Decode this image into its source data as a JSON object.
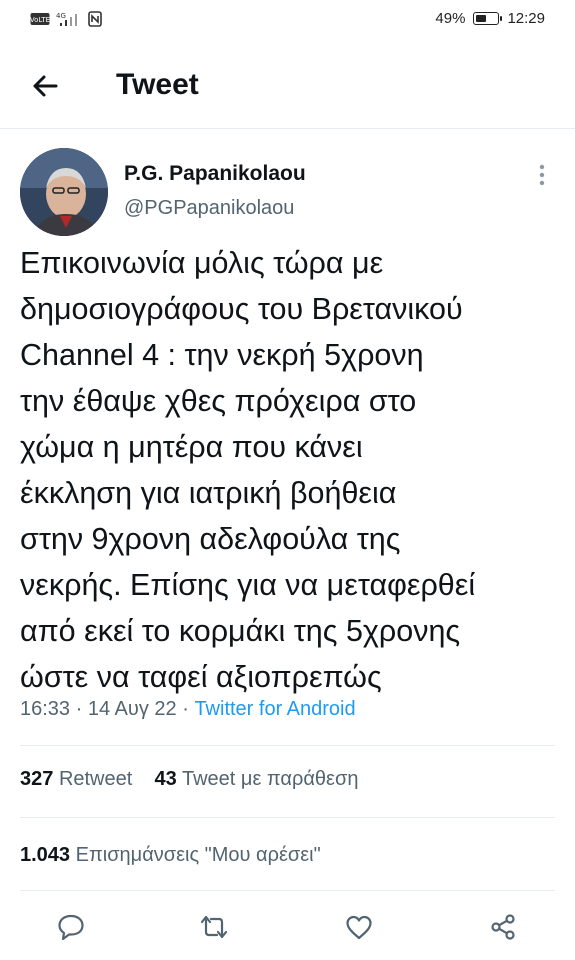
{
  "status_bar": {
    "left_icons": [
      "volte-icon",
      "4g-signal-icon",
      "nfc-icon"
    ],
    "battery_label": "49%",
    "battery_level": 0.49,
    "time": "12:29"
  },
  "header": {
    "title": "Tweet"
  },
  "tweet": {
    "author_name": "P.G. Papanikolaou",
    "author_handle": "@PGPapanikolaou",
    "text": "Επικοινωνία μόλις τώρα με\nδημοσιογράφους του Βρετανικού\nChannel 4 : την νεκρή 5χρονη\nτην έθαψε χθες πρόχειρα στο\nχώμα η μητέρα που κάνει\nέκκληση για ιατρική βοήθεια\nστην 9χρονη αδελφούλα της\nνεκρής. Επίσης για να μεταφερθεί\nαπό εκεί το κορμάκι της 5χρονης\nώστε να ταφεί αξιοπρεπώς",
    "time": "16:33",
    "date": "14 Αυγ 22",
    "separator": "·",
    "source": "Twitter for Android"
  },
  "stats": {
    "retweets_count": "327",
    "retweets_label": "Retweet",
    "quotes_count": "43",
    "quotes_label": "Tweet με παράθεση",
    "likes_count": "1.043",
    "likes_label": "Επισημάνσεις \"Μου αρέσει\""
  },
  "colors": {
    "text": "#0f1419",
    "secondary": "#536471",
    "link": "#1d9bf0",
    "divider": "#e6ecf0"
  }
}
